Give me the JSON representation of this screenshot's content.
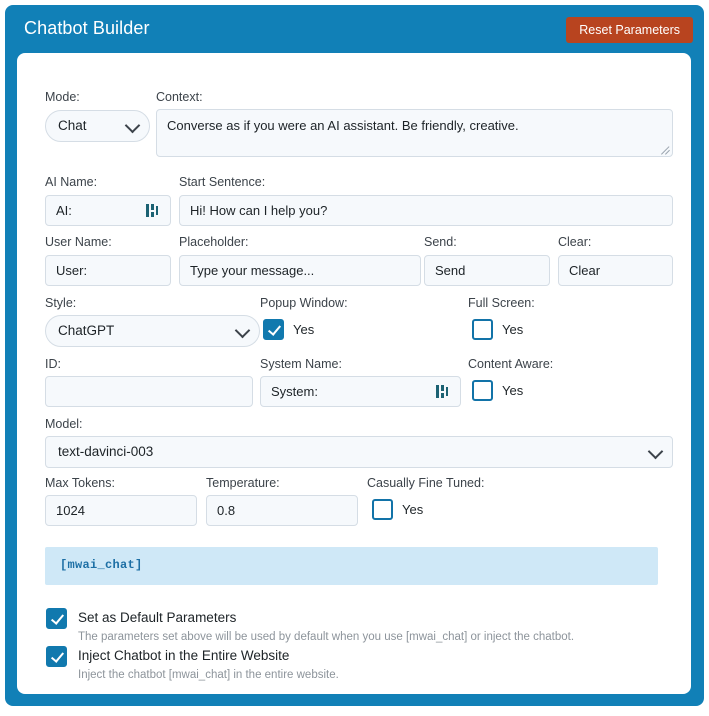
{
  "header": {
    "title": "Chatbot Builder",
    "reset_label": "Reset Parameters"
  },
  "fields": {
    "mode": {
      "label": "Mode:",
      "value": "Chat"
    },
    "context": {
      "label": "Context:",
      "value": "Converse as if you were an AI assistant. Be friendly, creative."
    },
    "ai_name": {
      "label": "AI Name:",
      "value": "AI:"
    },
    "start_sentence": {
      "label": "Start Sentence:",
      "value": "Hi! How can I help you?"
    },
    "user_name": {
      "label": "User Name:",
      "value": "User:"
    },
    "placeholder": {
      "label": "Placeholder:",
      "value": "Type your message..."
    },
    "send": {
      "label": "Send:",
      "value": "Send"
    },
    "clear": {
      "label": "Clear:",
      "value": "Clear"
    },
    "style": {
      "label": "Style:",
      "value": "ChatGPT"
    },
    "popup_window": {
      "label": "Popup Window:",
      "checkbox_label": "Yes",
      "checked": true
    },
    "full_screen": {
      "label": "Full Screen:",
      "checkbox_label": "Yes",
      "checked": false
    },
    "id": {
      "label": "ID:",
      "value": "",
      "placeholder": ""
    },
    "system_name": {
      "label": "System Name:",
      "value": "System:"
    },
    "content_aware": {
      "label": "Content Aware:",
      "checkbox_label": "Yes",
      "checked": false
    },
    "model": {
      "label": "Model:",
      "value": "text-davinci-003"
    },
    "max_tokens": {
      "label": "Max Tokens:",
      "value": "1024"
    },
    "temperature": {
      "label": "Temperature:",
      "value": "0.8"
    },
    "casually_fine_tuned": {
      "label": "Casually Fine Tuned:",
      "checkbox_label": "Yes",
      "checked": false
    }
  },
  "shortcode": {
    "text": "[mwai_chat]"
  },
  "options": [
    {
      "title": "Set as Default Parameters",
      "description": "The parameters set above will be used by default when you use [mwai_chat] or inject the chatbot.",
      "checked": true
    },
    {
      "title": "Inject Chatbot in the Entire Website",
      "description": "Inject the chatbot [mwai_chat] in the entire website.",
      "checked": true
    }
  ],
  "icons": {
    "bars": "bars-icon",
    "chevron": "chevron-down-icon"
  },
  "colors": {
    "panel_blue": "#1180b7",
    "reset_button": "#b8441f",
    "checkbox_blue": "#1179ae",
    "banner_bg": "#cfe8f7",
    "banner_text": "#1d6fa5"
  }
}
